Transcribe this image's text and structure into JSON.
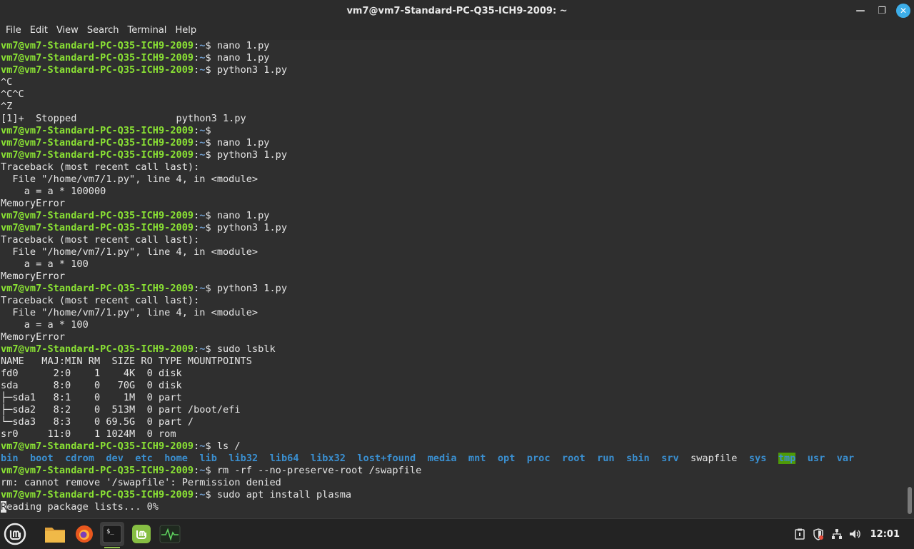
{
  "window": {
    "title": "vm7@vm7-Standard-PC-Q35-ICH9-2009: ~",
    "minimize_icon": "minimize-icon",
    "maximize_icon": "maximize-icon",
    "close_icon": "close-icon"
  },
  "menu": {
    "items": [
      "File",
      "Edit",
      "View",
      "Search",
      "Terminal",
      "Help"
    ]
  },
  "terminal": {
    "prompt_user": "vm7@vm7-Standard-PC-Q35-ICH9-2009",
    "prompt_path": "~",
    "lines": [
      {
        "type": "cmd",
        "text": "nano 1.py"
      },
      {
        "type": "cmd",
        "text": "nano 1.py"
      },
      {
        "type": "cmd",
        "text": "python3 1.py"
      },
      {
        "type": "out",
        "text": "^C"
      },
      {
        "type": "out",
        "text": "^C^C"
      },
      {
        "type": "out",
        "text": "^Z"
      },
      {
        "type": "out",
        "text": "[1]+  Stopped                 python3 1.py"
      },
      {
        "type": "cmd",
        "text": ""
      },
      {
        "type": "cmd",
        "text": "nano 1.py"
      },
      {
        "type": "cmd",
        "text": "python3 1.py"
      },
      {
        "type": "out",
        "text": "Traceback (most recent call last):"
      },
      {
        "type": "out",
        "text": "  File \"/home/vm7/1.py\", line 4, in <module>"
      },
      {
        "type": "out",
        "text": "    a = a * 100000"
      },
      {
        "type": "out",
        "text": "MemoryError"
      },
      {
        "type": "cmd",
        "text": "nano 1.py"
      },
      {
        "type": "cmd",
        "text": "python3 1.py"
      },
      {
        "type": "out",
        "text": "Traceback (most recent call last):"
      },
      {
        "type": "out",
        "text": "  File \"/home/vm7/1.py\", line 4, in <module>"
      },
      {
        "type": "out",
        "text": "    a = a * 100"
      },
      {
        "type": "out",
        "text": "MemoryError"
      },
      {
        "type": "cmd",
        "text": "python3 1.py"
      },
      {
        "type": "out",
        "text": "Traceback (most recent call last):"
      },
      {
        "type": "out",
        "text": "  File \"/home/vm7/1.py\", line 4, in <module>"
      },
      {
        "type": "out",
        "text": "    a = a * 100"
      },
      {
        "type": "out",
        "text": "MemoryError"
      },
      {
        "type": "cmd",
        "text": "sudo lsblk"
      },
      {
        "type": "out",
        "text": "NAME   MAJ:MIN RM  SIZE RO TYPE MOUNTPOINTS"
      },
      {
        "type": "out",
        "text": "fd0      2:0    1    4K  0 disk"
      },
      {
        "type": "out",
        "text": "sda      8:0    0   70G  0 disk"
      },
      {
        "type": "out",
        "text": "├─sda1   8:1    0    1M  0 part"
      },
      {
        "type": "out",
        "text": "├─sda2   8:2    0  513M  0 part /boot/efi"
      },
      {
        "type": "out",
        "text": "└─sda3   8:3    0 69.5G  0 part /"
      },
      {
        "type": "out",
        "text": "sr0     11:0    1 1024M  0 rom"
      },
      {
        "type": "cmd",
        "text": "ls /"
      },
      {
        "type": "ls"
      },
      {
        "type": "cmd",
        "text": "rm -rf --no-preserve-root /swapfile"
      },
      {
        "type": "out",
        "text": "rm: cannot remove '/swapfile': Permission denied"
      },
      {
        "type": "cmd",
        "text": "sudo apt install plasma"
      },
      {
        "type": "cursor",
        "cursor_char": "R",
        "text": "eading package lists... 0%"
      }
    ],
    "ls_entries": [
      {
        "name": "bin",
        "kind": "exec"
      },
      {
        "name": "boot",
        "kind": "dir"
      },
      {
        "name": "cdrom",
        "kind": "dir"
      },
      {
        "name": "dev",
        "kind": "dir"
      },
      {
        "name": "etc",
        "kind": "dir"
      },
      {
        "name": "home",
        "kind": "dir"
      },
      {
        "name": "lib",
        "kind": "exec"
      },
      {
        "name": "lib32",
        "kind": "exec"
      },
      {
        "name": "lib64",
        "kind": "exec"
      },
      {
        "name": "libx32",
        "kind": "exec"
      },
      {
        "name": "lost+found",
        "kind": "dir"
      },
      {
        "name": "media",
        "kind": "dir"
      },
      {
        "name": "mnt",
        "kind": "dir"
      },
      {
        "name": "opt",
        "kind": "dir"
      },
      {
        "name": "proc",
        "kind": "dir"
      },
      {
        "name": "root",
        "kind": "dir"
      },
      {
        "name": "run",
        "kind": "dir"
      },
      {
        "name": "sbin",
        "kind": "exec"
      },
      {
        "name": "srv",
        "kind": "dir"
      },
      {
        "name": "swapfile",
        "kind": "file"
      },
      {
        "name": "sys",
        "kind": "dir"
      },
      {
        "name": "tmp",
        "kind": "tmp"
      },
      {
        "name": "usr",
        "kind": "dir"
      },
      {
        "name": "var",
        "kind": "dir"
      }
    ]
  },
  "taskbar": {
    "apps": [
      {
        "name": "mint-menu-icon"
      },
      {
        "name": "files-icon"
      },
      {
        "name": "firefox-icon"
      },
      {
        "name": "terminal-icon"
      },
      {
        "name": "mintinstall-icon"
      },
      {
        "name": "system-monitor-icon"
      }
    ],
    "tray": [
      "clipboard-icon",
      "shield-icon",
      "network-icon",
      "volume-icon"
    ],
    "clock": "12:01"
  },
  "colors": {
    "prompt_user": "#8ae234",
    "prompt_path": "#729fcf",
    "directory": "#3a8fd0",
    "executable": "#4e9a06",
    "accent_close": "#3daee9"
  }
}
